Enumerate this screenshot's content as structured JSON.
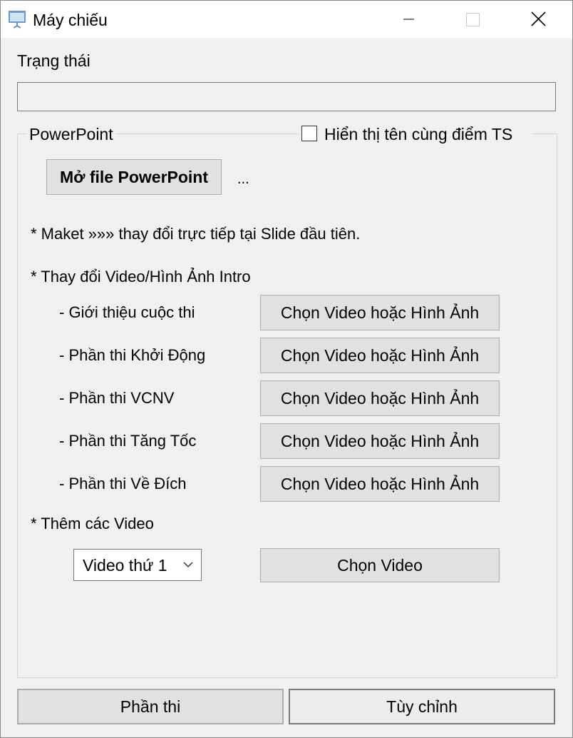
{
  "window": {
    "title": "Máy chiếu"
  },
  "status": {
    "label": "Trạng thái",
    "value": ""
  },
  "powerpoint": {
    "group_title": "PowerPoint",
    "show_name_checkbox_label": "Hiển thị tên cùng điểm TS",
    "show_name_checked": false,
    "open_button_label": "Mở file PowerPoint",
    "file_name": "...",
    "maket_note": "* Maket »»» thay đổi trực tiếp tại Slide đầu tiên.",
    "intro_heading": "* Thay đổi Video/Hình Ảnh Intro",
    "intro_rows": [
      {
        "label": "- Giới thiệu cuộc thi",
        "button": "Chọn Video hoặc Hình Ảnh"
      },
      {
        "label": "- Phần thi Khởi Động",
        "button": "Chọn Video hoặc Hình Ảnh"
      },
      {
        "label": "- Phần thi VCNV",
        "button": "Chọn Video hoặc Hình Ảnh"
      },
      {
        "label": "- Phần thi Tăng Tốc",
        "button": "Chọn Video hoặc Hình Ảnh"
      },
      {
        "label": "- Phần thi Về Đích",
        "button": "Chọn Video hoặc Hình Ảnh"
      }
    ],
    "add_videos_heading": "* Thêm các Video",
    "video_select_value": "Video thứ 1",
    "choose_video_button": "Chọn Video"
  },
  "footer": {
    "parts_button": "Phần thi",
    "custom_button": "Tùy chỉnh"
  }
}
